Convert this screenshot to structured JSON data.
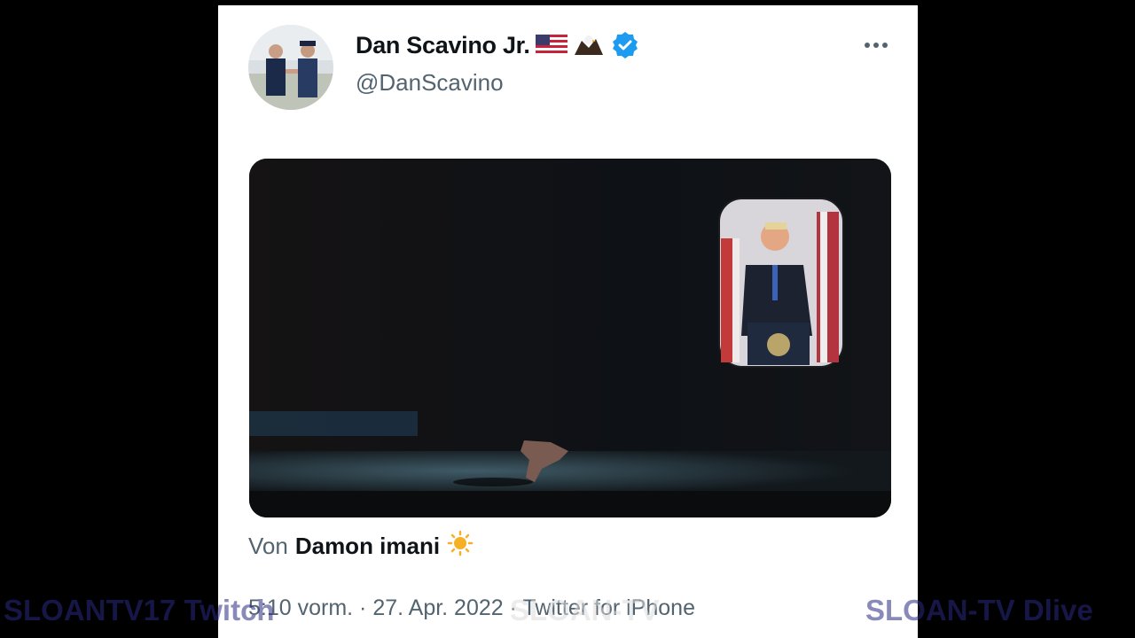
{
  "tweet": {
    "display_name": "Dan Scavino Jr.",
    "name_emojis": [
      "flag-us-icon",
      "eagle-icon"
    ],
    "verified": true,
    "handle": "@DanScavino",
    "more_icon": "more-dots-icon",
    "attribution_prefix": "Von",
    "attribution_name": "Damon imani",
    "attribution_emoji": "sun-icon",
    "timestamp": "5:10 vorm. · 27. Apr. 2022 · Twitter for iPhone"
  },
  "watermarks": {
    "left": "SLOANTV17 Twitch",
    "center": "SLOAN-TV",
    "right": "SLOAN-TV Dlive"
  },
  "colors": {
    "verified": "#1d9bf0",
    "text_primary": "#0f1419",
    "text_secondary": "#536471"
  }
}
